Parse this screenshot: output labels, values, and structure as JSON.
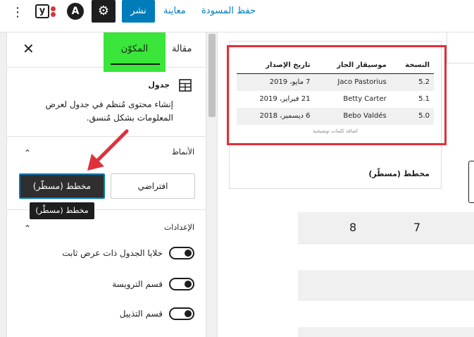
{
  "toolbar": {
    "more_glyph": "⋮",
    "yoast_letter": "y",
    "astra_letter": "A",
    "settings_glyph": "⚙",
    "publish": "نشر",
    "preview": "معاينة",
    "save_draft": "حفظ المسودة"
  },
  "sidebar": {
    "tab_post": "مقالة",
    "tab_block": "المكوّن",
    "close_glyph": "✕",
    "block": {
      "title": "جدول",
      "description": "إنشاء محتوى مُنظم في جدول لعرض المعلومات بشكل مُنسق."
    },
    "styles": {
      "title": "الأنماط",
      "chevron": "⌃",
      "default_label": "افتراضي",
      "stripes_label": "مخطط (مسطّر)",
      "tooltip": "مخطط (مسطّر)"
    },
    "settings": {
      "title": "الإعدادات",
      "chevron": "⌃",
      "toggles": [
        {
          "label": "خلايا الجدول ذات عرض ثابت",
          "on": true
        },
        {
          "label": "قسم الترويسة",
          "on": true
        },
        {
          "label": "قسم التذييل",
          "on": true
        }
      ]
    }
  },
  "canvas": {
    "preview_table": {
      "headers": [
        "النسخة",
        "موسيقار الجاز",
        "تاريخ الإصدار"
      ],
      "rows": [
        [
          "5.2",
          "Jaco Pastorius",
          "7 مايو، 2019"
        ],
        [
          "5.1",
          "Betty Carter",
          "21 فبراير، 2019"
        ],
        [
          "5.0",
          "Bebo Valdés",
          "6 ديسمبر، 2018"
        ]
      ],
      "caption": "اضافة كلمات توضيحية"
    },
    "style_label": "مخطط (مسطّر)",
    "grid_numbers": [
      "8",
      "7"
    ]
  },
  "colors": {
    "accent": "#007cba",
    "highlight": "#e0303a",
    "tab_highlight": "#39e639",
    "dark": "#1e1e1e"
  }
}
